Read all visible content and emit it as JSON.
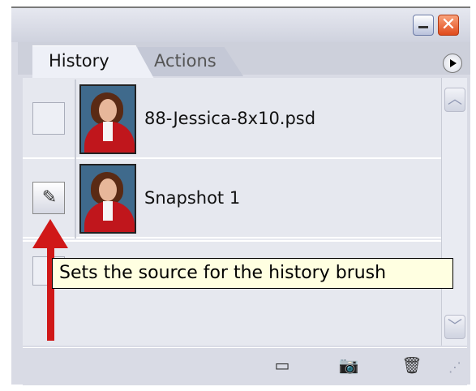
{
  "window": {
    "minimize_symbol": "–",
    "close_symbol": "✕"
  },
  "tabs": [
    {
      "label": "History",
      "active": true
    },
    {
      "label": "Actions",
      "active": false
    }
  ],
  "history_items": [
    {
      "label": "88-Jessica-8x10.psd",
      "source_set": false,
      "icon": "empty-checkbox"
    },
    {
      "label": "Snapshot 1",
      "source_set": true,
      "icon": "history-brush-icon"
    }
  ],
  "tooltip": {
    "text": "Sets the source for the history brush"
  },
  "bottom_toolbar": {
    "buttons": [
      {
        "name": "new-document-from-state",
        "icon": "document-icon",
        "glyph": "▭"
      },
      {
        "name": "new-snapshot",
        "icon": "camera-icon",
        "glyph": "📷"
      },
      {
        "name": "delete-state",
        "icon": "trash-icon",
        "glyph": "🗑"
      }
    ]
  },
  "scroll": {
    "up_glyph": "︿",
    "down_glyph": "﹀"
  },
  "colors": {
    "annotation_arrow": "#d01818",
    "tooltip_bg": "#ffffe1"
  }
}
